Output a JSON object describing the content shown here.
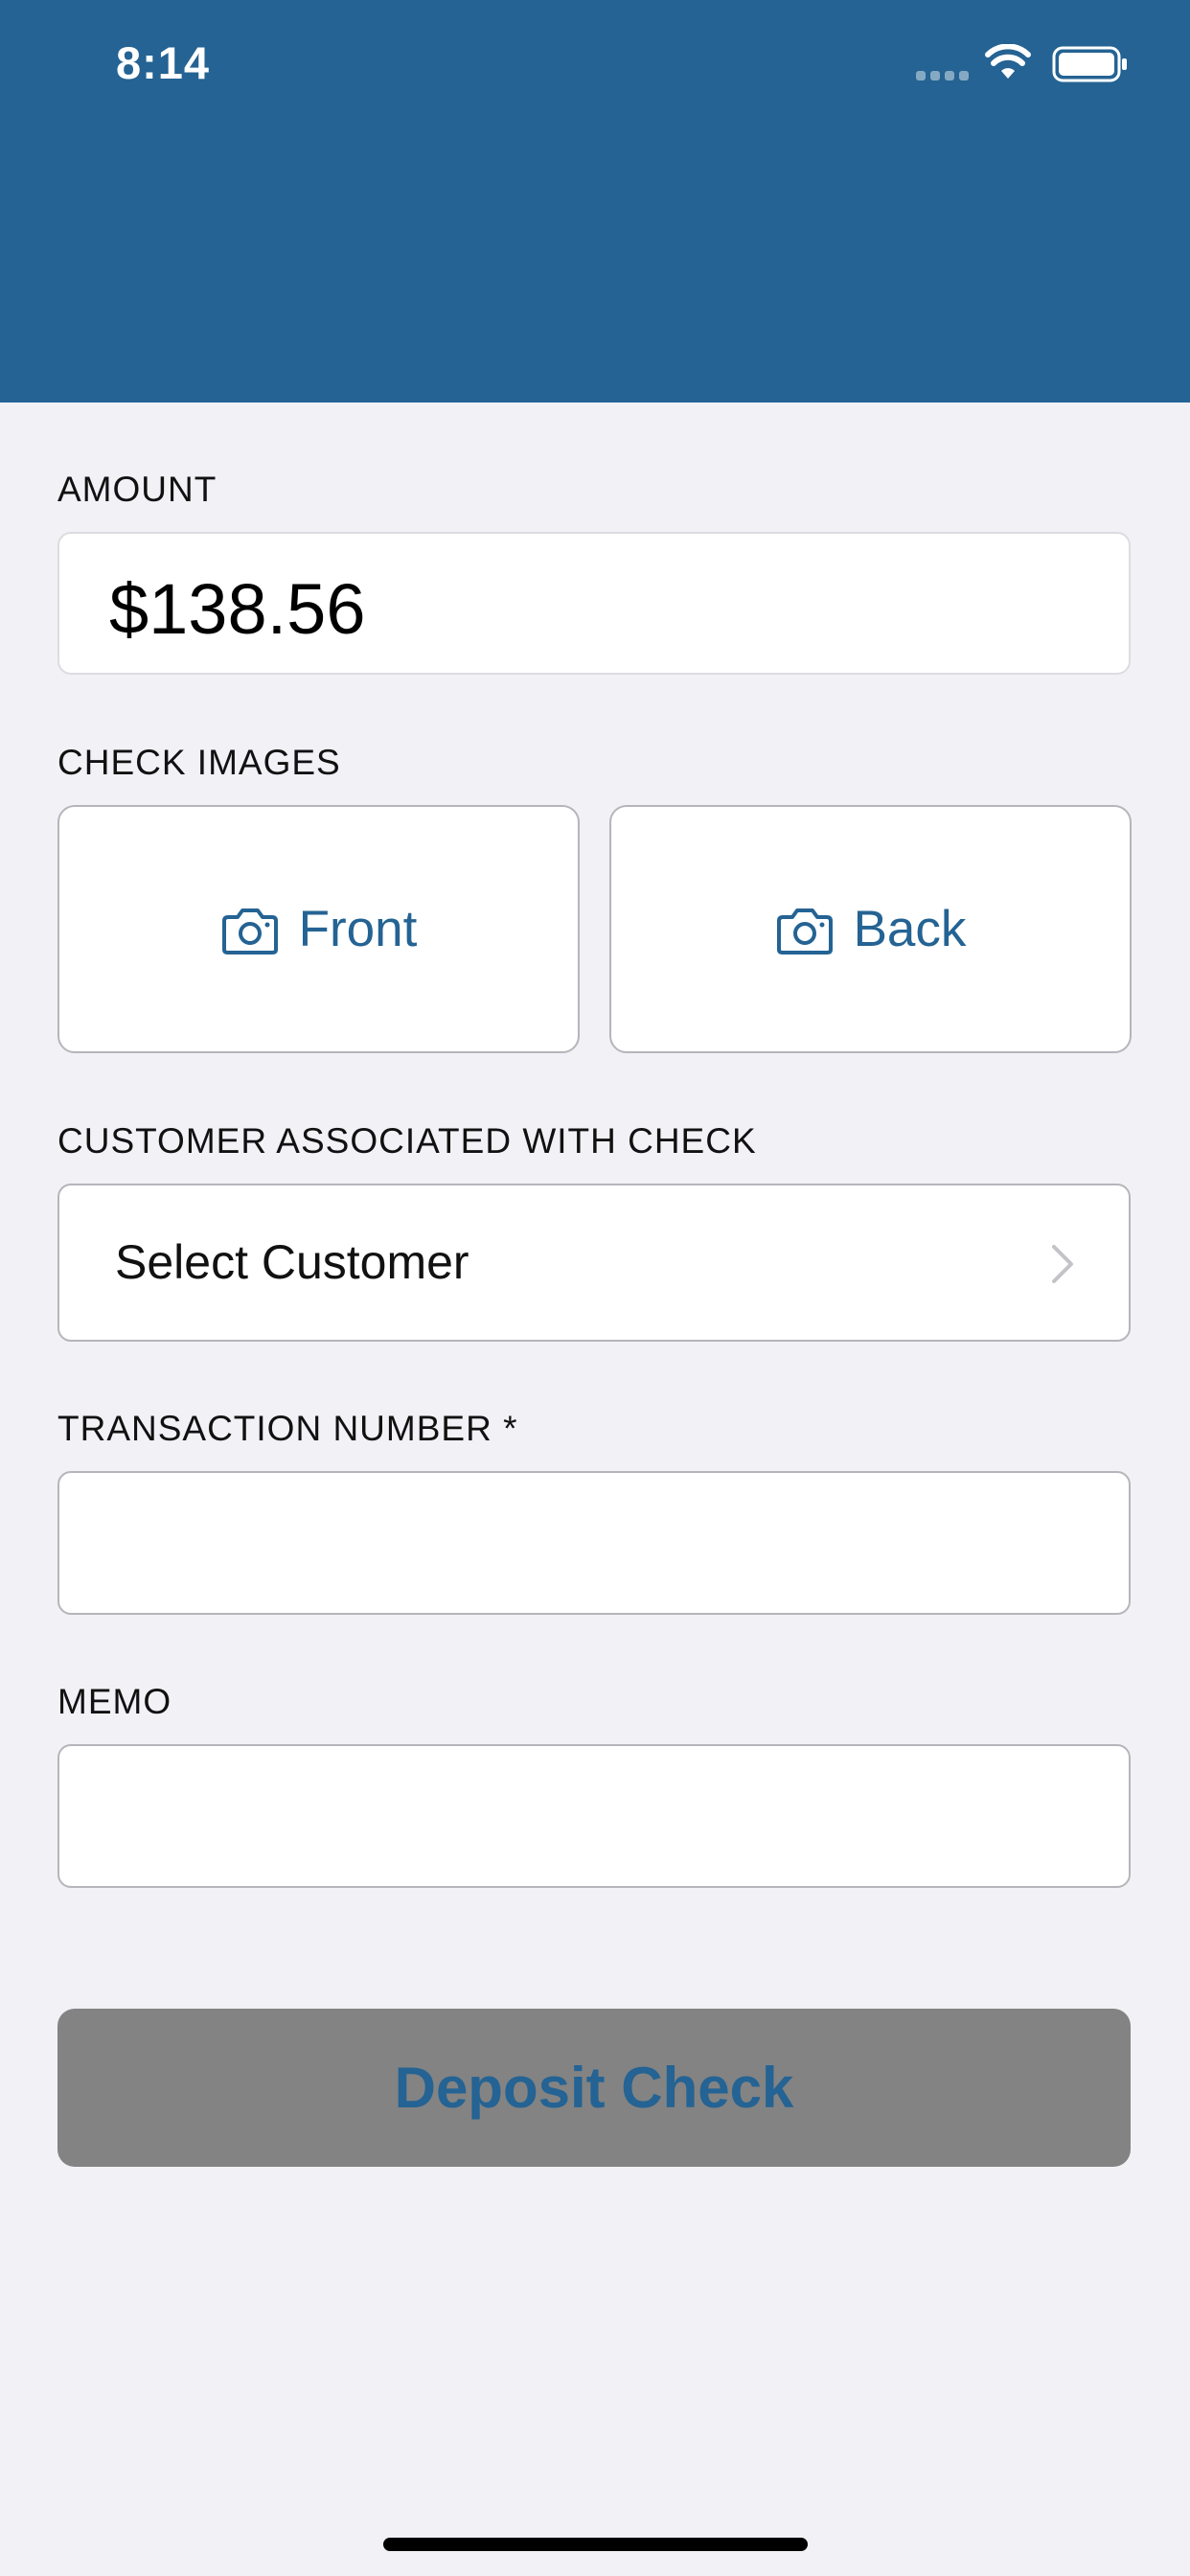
{
  "status_bar": {
    "time": "8:14"
  },
  "colors": {
    "header": "#246393",
    "accent": "#246393",
    "background": "#f1f1f6",
    "button_disabled": "#838383"
  },
  "amount": {
    "label": "AMOUNT",
    "value": "$138.56"
  },
  "check_images": {
    "label": "CHECK IMAGES",
    "front_label": "Front",
    "back_label": "Back",
    "icon": "camera-icon"
  },
  "customer": {
    "label": "CUSTOMER ASSOCIATED WITH CHECK",
    "placeholder": "Select Customer",
    "icon": "chevron-right-icon"
  },
  "transaction": {
    "label": "TRANSACTION NUMBER *",
    "value": ""
  },
  "memo": {
    "label": "MEMO",
    "value": ""
  },
  "deposit_button": {
    "label": "Deposit Check"
  }
}
